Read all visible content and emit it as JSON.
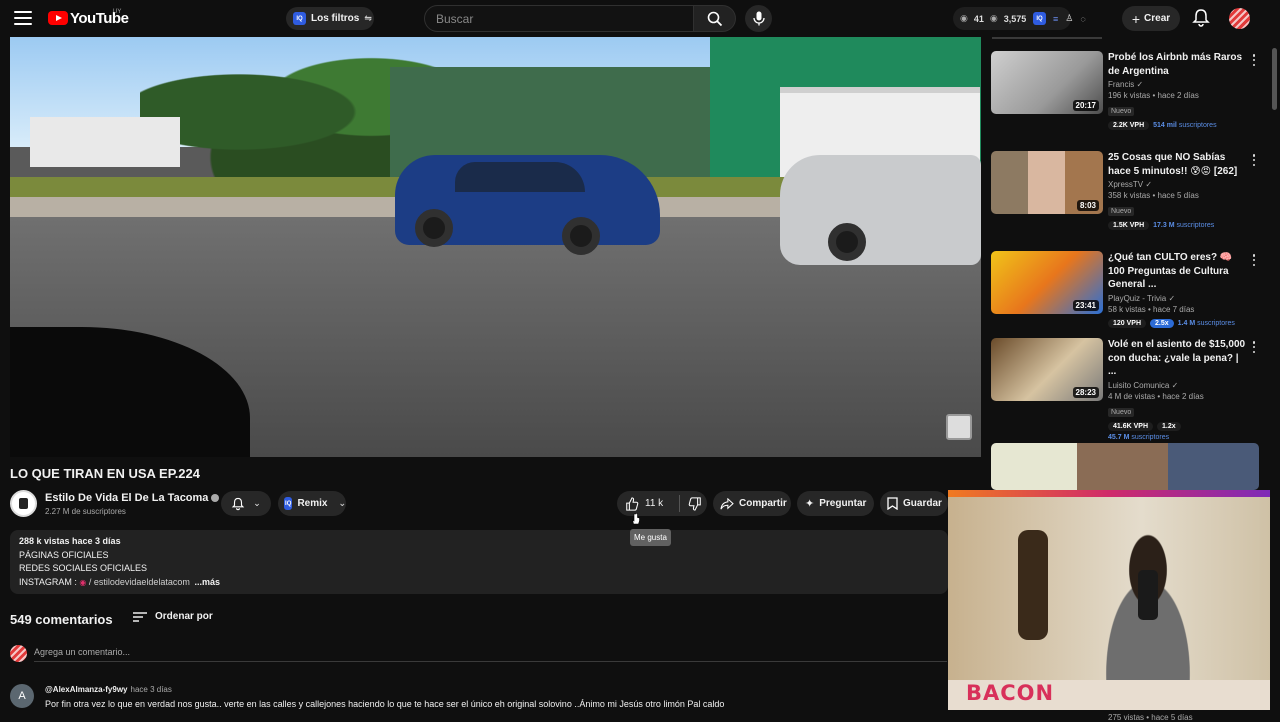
{
  "header": {
    "logo_text": "YouTube",
    "country_code": "UY",
    "filters_label": "Los filtros",
    "search_placeholder": "Buscar",
    "stats_a": "41",
    "stats_b": "3,575",
    "create_label": "Crear"
  },
  "video": {
    "title": "LO QUE TIRAN EN USA EP.224",
    "channel_name": "Estilo De Vida El De La Tacoma",
    "channel_subs": "2.27 M de suscriptores",
    "remix_label": "Remix",
    "like_count": "11 k",
    "share_label": "Compartir",
    "ask_label": "Preguntar",
    "save_label": "Guardar",
    "like_tooltip": "Me gusta"
  },
  "description": {
    "stats": "288 k vistas  hace 3 días",
    "line1": "PÁGINAS OFICIALES",
    "line2": "REDES SOCIALES OFICIALES",
    "instagram_label": "INSTAGRAM :",
    "instagram_link": "/ estilodevidaeldelatacom",
    "more": "...más"
  },
  "comments": {
    "count_label": "549 comentarios",
    "sort_label": "Ordenar por",
    "add_placeholder": "Agrega un comentario...",
    "first": {
      "avatar_letter": "A",
      "author": "@AlexAlmanza-fy9wy",
      "time": "hace 3 días",
      "text": "Por fin otra vez lo que en verdad nos gusta.. verte en las calles y callejones haciendo lo que te hace ser el único eh original solovino ..Ánimo mi Jesús otro limón Pal caldo"
    }
  },
  "sidebar": [
    {
      "title": "Probé los Airbnb más Raros de Argentina",
      "channel": "Francis",
      "meta": "196 k vistas • hace 2 días",
      "badge": "Nuevo",
      "duration": "20:17",
      "vph": "2.2K VPH",
      "mult": "",
      "subs_num": "514 mil",
      "subs_word": "suscriptores"
    },
    {
      "title": "25 Cosas que NO Sabías hace 5 minutos!! 😰😡 [262]",
      "channel": "XpressTV",
      "meta": "358 k vistas • hace 5 días",
      "badge": "Nuevo",
      "duration": "8:03",
      "vph": "1.5K VPH",
      "mult": "",
      "subs_num": "17.3 M",
      "subs_word": "suscriptores"
    },
    {
      "title": "¿Qué tan CULTO eres? 🧠 100 Preguntas de Cultura General ...",
      "channel": "PlayQuiz - Trivia",
      "meta": "58 k vistas • hace 7 días",
      "badge": "",
      "duration": "23:41",
      "vph": "120 VPH",
      "mult": "2.5x",
      "subs_num": "1.4 M",
      "subs_word": "suscriptores"
    },
    {
      "title": "Volé en el asiento de $15,000 con ducha: ¿vale la pena? | ...",
      "channel": "Luisito Comunica",
      "meta": "4 M de vistas • hace 2 días",
      "badge": "Nuevo",
      "duration": "28:23",
      "vph": "41.6K VPH",
      "mult": "1.2x",
      "subs_num": "45.7 M",
      "subs_word": "suscriptores"
    }
  ],
  "sidebar_partial_meta": "275 vistas • hace 5 días",
  "webcam": {
    "banner_text": "BACON"
  }
}
